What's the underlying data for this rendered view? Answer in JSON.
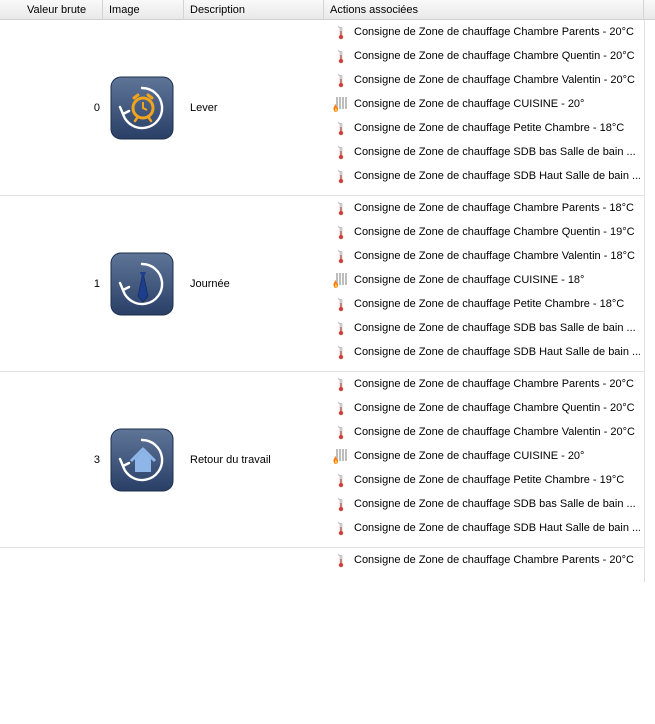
{
  "columns": [
    "Valeur brute",
    "Image",
    "Description",
    "Actions associées",
    ""
  ],
  "rows": [
    {
      "value": "0",
      "icon": "alarm-clock-icon",
      "description": "Lever",
      "actions": [
        {
          "icon": "thermometer-icon",
          "text": "Consigne de Zone de chauffage Chambre Parents - 20°C"
        },
        {
          "icon": "thermometer-icon",
          "text": "Consigne de Zone de chauffage Chambre Quentin - 20°C"
        },
        {
          "icon": "thermometer-icon",
          "text": "Consigne de Zone de chauffage Chambre Valentin - 20°C"
        },
        {
          "icon": "radiator-icon",
          "text": "Consigne de Zone de chauffage CUISINE - 20°"
        },
        {
          "icon": "thermometer-icon",
          "text": "Consigne de Zone de chauffage Petite Chambre - 18°C"
        },
        {
          "icon": "thermometer-icon",
          "text": "Consigne de Zone de chauffage SDB bas Salle de bain ..."
        },
        {
          "icon": "thermometer-icon",
          "text": "Consigne de Zone de chauffage SDB Haut Salle de bain ..."
        }
      ]
    },
    {
      "value": "1",
      "icon": "necktie-icon",
      "description": "Journée",
      "actions": [
        {
          "icon": "thermometer-icon",
          "text": "Consigne de Zone de chauffage Chambre Parents - 18°C"
        },
        {
          "icon": "thermometer-icon",
          "text": "Consigne de Zone de chauffage Chambre Quentin - 19°C"
        },
        {
          "icon": "thermometer-icon",
          "text": "Consigne de Zone de chauffage Chambre Valentin - 18°C"
        },
        {
          "icon": "radiator-icon",
          "text": "Consigne de Zone de chauffage CUISINE - 18°"
        },
        {
          "icon": "thermometer-icon",
          "text": "Consigne de Zone de chauffage Petite Chambre - 18°C"
        },
        {
          "icon": "thermometer-icon",
          "text": "Consigne de Zone de chauffage SDB bas Salle de bain ..."
        },
        {
          "icon": "thermometer-icon",
          "text": "Consigne de Zone de chauffage SDB Haut Salle de bain ..."
        }
      ]
    },
    {
      "value": "3",
      "icon": "house-icon",
      "description": "Retour du travail",
      "actions": [
        {
          "icon": "thermometer-icon",
          "text": "Consigne de Zone de chauffage Chambre Parents - 20°C"
        },
        {
          "icon": "thermometer-icon",
          "text": "Consigne de Zone de chauffage Chambre Quentin - 20°C"
        },
        {
          "icon": "thermometer-icon",
          "text": "Consigne de Zone de chauffage Chambre Valentin - 20°C"
        },
        {
          "icon": "radiator-icon",
          "text": "Consigne de Zone de chauffage CUISINE - 20°"
        },
        {
          "icon": "thermometer-icon",
          "text": "Consigne de Zone de chauffage Petite Chambre - 19°C"
        },
        {
          "icon": "thermometer-icon",
          "text": "Consigne de Zone de chauffage SDB bas Salle de bain ..."
        },
        {
          "icon": "thermometer-icon",
          "text": "Consigne de Zone de chauffage SDB Haut Salle de bain ..."
        }
      ]
    },
    {
      "value": "",
      "icon": "",
      "description": "",
      "actions": [
        {
          "icon": "thermometer-icon",
          "text": "Consigne de Zone de chauffage Chambre Parents - 20°C"
        }
      ]
    }
  ],
  "colors": {
    "icon_bg_top": "#5f7598",
    "icon_bg_bottom": "#2a3f66",
    "alarm_orange": "#f2a41c",
    "house_blue": "#8fb6e8",
    "tie_navy": "#1d3e8c",
    "thermo_red": "#d0403a"
  }
}
